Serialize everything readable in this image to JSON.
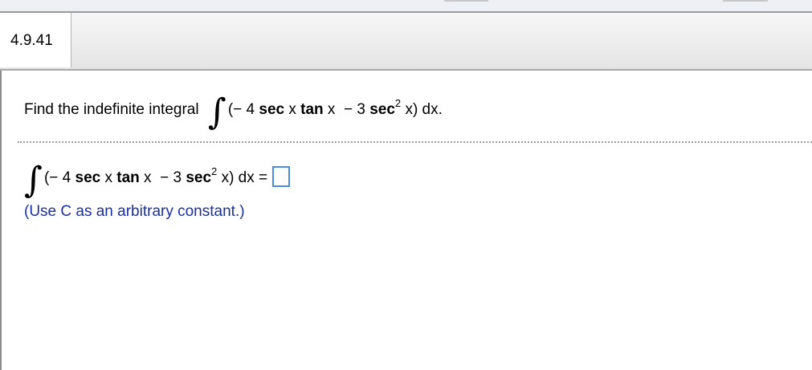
{
  "problem_id": "4.9.41",
  "question": {
    "lead_text": "Find the indefinite integral",
    "integral_sign": "∫",
    "open_paren": "(",
    "coef1": "− 4",
    "sec1": "sec",
    "x1": "x",
    "tan1": "tan",
    "x2": "x",
    "minus": "− 3",
    "sec2": "sec",
    "exp": "2",
    "x3": "x)",
    "dx": "dx."
  },
  "answer": {
    "integral_sign": "∫",
    "open_paren": "(",
    "coef1": "− 4",
    "sec1": "sec",
    "x1": "x",
    "tan1": "tan",
    "x2": "x",
    "minus": "− 3",
    "sec2": "sec",
    "exp": "2",
    "x3": "x)",
    "dx": "dx =",
    "input_value": ""
  },
  "hint": "(Use C as an arbitrary constant.)",
  "colors": {
    "hint_text": "#1a2fa0",
    "answer_box_border": "#4a8de0"
  }
}
